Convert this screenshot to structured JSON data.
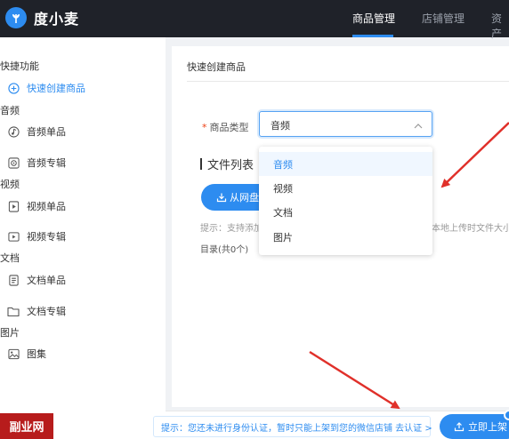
{
  "app": {
    "name": "度小麦",
    "nav": [
      {
        "label": "商品管理",
        "active": true
      },
      {
        "label": "店铺管理",
        "active": false
      },
      {
        "label": "资产",
        "active": false
      }
    ]
  },
  "sidebar": {
    "quick_section": "快捷功能",
    "quick_create": "快速创建商品",
    "audio_section": "音频",
    "audio_single": "音频单品",
    "audio_album": "音频专辑",
    "video_section": "视频",
    "video_single": "视频单品",
    "video_album": "视频专辑",
    "doc_section": "文档",
    "doc_single": "文档单品",
    "doc_album": "文档专辑",
    "image_section": "图片",
    "image_set": "图集"
  },
  "main": {
    "title": "快速创建商品",
    "product_type_label": "商品类型",
    "product_type_value": "音频",
    "product_type_options": [
      "音频",
      "视频",
      "文档",
      "图片"
    ],
    "file_list_title": "文件列表",
    "from_pan_button": "从网盘",
    "tip_left": "提示：支持添加",
    "tip_right": "本地上传时文件大小不",
    "dir_count": "目录(共0个)"
  },
  "footer": {
    "notice": "提示：您还未进行身份认证，暂时只能上架到您的微信店铺 去认证 >",
    "publish_button": "立即上架"
  },
  "watermark": "副业网",
  "colors": {
    "accent": "#2d8cf0",
    "topbar": "#1f2229",
    "annotation": "#e0302a"
  }
}
